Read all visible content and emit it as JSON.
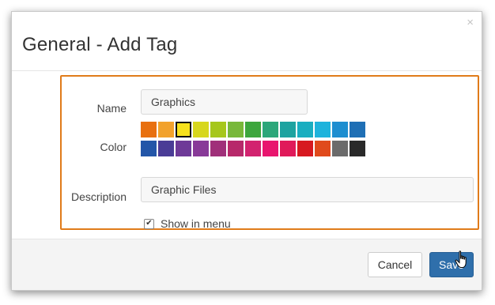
{
  "dialog": {
    "title": "General - Add Tag",
    "close_glyph": "×"
  },
  "form": {
    "name_label": "Name",
    "name_value": "Graphics",
    "color_label": "Color",
    "description_label": "Description",
    "description_value": "Graphic Files",
    "show_in_menu_label": "Show in menu",
    "show_in_menu_checked": true,
    "selected_color_index": 2,
    "colors": [
      [
        "#e8700f",
        "#f2a22c",
        "#f6e11c",
        "#d7d71e",
        "#a6c71c",
        "#78b83a",
        "#3da63d",
        "#2ca77a",
        "#1ea3a0",
        "#19aec0",
        "#1eb3dc",
        "#1d8ed0",
        "#1f6fb5"
      ],
      [
        "#2356a8",
        "#4a3c96",
        "#6e3a98",
        "#883a98",
        "#a0307a",
        "#b7296a",
        "#d2236f",
        "#e8156e",
        "#e01a5a",
        "#d71920",
        "#e04a1c",
        "#6b6b6b",
        "#2a2a2a"
      ]
    ]
  },
  "footer": {
    "cancel_label": "Cancel",
    "save_label": "Save"
  },
  "accent": {
    "highlight_border": "#e07b1a",
    "primary_button": "#2f6fab"
  }
}
